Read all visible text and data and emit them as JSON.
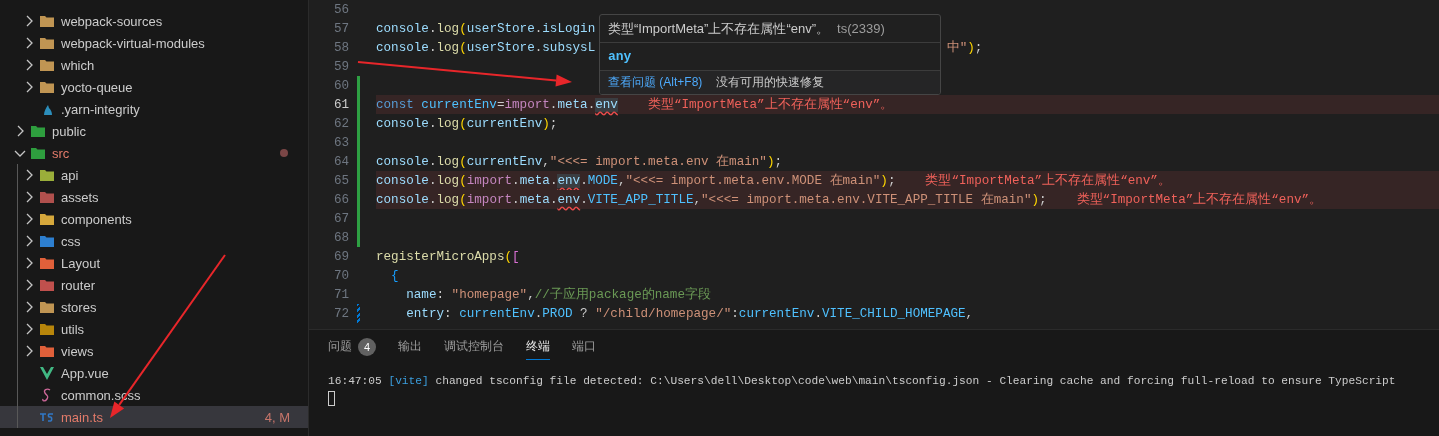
{
  "explorer": {
    "continued_children": [
      {
        "name": "webpack-sources",
        "kind": "folder",
        "color": "#c09553",
        "expanded": false,
        "selected": false
      },
      {
        "name": "webpack-virtual-modules",
        "kind": "folder",
        "color": "#c09553",
        "expanded": false,
        "selected": false
      },
      {
        "name": "which",
        "kind": "folder",
        "color": "#c09553",
        "expanded": false,
        "selected": false
      },
      {
        "name": "yocto-queue",
        "kind": "folder",
        "color": "#c09553",
        "expanded": false,
        "selected": false
      },
      {
        "name": ".yarn-integrity",
        "kind": "yarn",
        "selected": false
      }
    ],
    "items": [
      {
        "name": "public",
        "kind": "folder",
        "color": "#2e9e3e",
        "expanded": false,
        "selected": false
      },
      {
        "name": "src",
        "kind": "folder",
        "color": "#2e9e3e",
        "expanded": true,
        "selected": false,
        "modified": true,
        "dot": true,
        "children": [
          {
            "name": "api",
            "kind": "folder",
            "color": "#9aae3a",
            "expanded": false,
            "selected": false
          },
          {
            "name": "assets",
            "kind": "folder",
            "color": "#b0504d",
            "expanded": false,
            "selected": false
          },
          {
            "name": "components",
            "kind": "folder",
            "color": "#d6a83c",
            "expanded": false,
            "selected": false
          },
          {
            "name": "css",
            "kind": "folder",
            "color": "#2d7fd0",
            "expanded": false,
            "selected": false
          },
          {
            "name": "Layout",
            "kind": "folder",
            "color": "#e0603a",
            "expanded": false,
            "selected": false
          },
          {
            "name": "router",
            "kind": "folder",
            "color": "#c0504d",
            "expanded": false,
            "selected": false
          },
          {
            "name": "stores",
            "kind": "folder",
            "color": "#c09553",
            "expanded": false,
            "selected": false
          },
          {
            "name": "utils",
            "kind": "folder",
            "color": "#b8860b",
            "expanded": false,
            "selected": false
          },
          {
            "name": "views",
            "kind": "folder",
            "color": "#e0603a",
            "expanded": false,
            "selected": false
          },
          {
            "name": "App.vue",
            "kind": "vue",
            "selected": false
          },
          {
            "name": "common.scss",
            "kind": "sass",
            "selected": false
          },
          {
            "name": "main.ts",
            "kind": "ts",
            "selected": true,
            "modified": true,
            "badge": "4, M"
          }
        ]
      }
    ]
  },
  "editor": {
    "lines": [
      {
        "number": "56",
        "current": false
      },
      {
        "number": "57",
        "current": false,
        "tokens": [
          {
            "text": "console",
            "kind": "var"
          },
          {
            "text": ".",
            "kind": "punct"
          },
          {
            "text": "log",
            "kind": "func"
          },
          {
            "text": "(",
            "kind": "b1"
          },
          {
            "text": "userStore",
            "kind": "var"
          },
          {
            "text": ".",
            "kind": "punct"
          },
          {
            "text": "isLogin",
            "kind": "var"
          }
        ]
      },
      {
        "number": "58",
        "current": false,
        "tokens": [
          {
            "text": "console",
            "kind": "var"
          },
          {
            "text": ".",
            "kind": "punct"
          },
          {
            "text": "log",
            "kind": "func"
          },
          {
            "text": "(",
            "kind": "b1"
          },
          {
            "text": "userStore",
            "kind": "var"
          },
          {
            "text": ".",
            "kind": "punct"
          },
          {
            "text": "subsysL",
            "kind": "var"
          },
          {
            "text": "中\"",
            "kind": "string",
            "after_popup": true
          },
          {
            "text": ")",
            "kind": "b1"
          },
          {
            "text": ";",
            "kind": "punct"
          }
        ]
      },
      {
        "number": "59",
        "current": false
      },
      {
        "number": "60",
        "current": false,
        "added": true
      },
      {
        "number": "61",
        "current": true,
        "added": true,
        "error": "类型“ImportMeta”上不存在属性“env”。",
        "tokens": [
          {
            "text": "const",
            "kind": "keyword"
          },
          {
            "text": " currentEnv",
            "kind": "const"
          },
          {
            "text": "=",
            "kind": "punct"
          },
          {
            "text": "import",
            "kind": "control"
          },
          {
            "text": ".",
            "kind": "punct"
          },
          {
            "text": "meta",
            "kind": "var"
          },
          {
            "text": ".",
            "kind": "punct"
          },
          {
            "text": "env",
            "kind": "var",
            "squiggle": true,
            "highlight": true
          }
        ]
      },
      {
        "number": "62",
        "current": false,
        "added": true,
        "tokens": [
          {
            "text": "console",
            "kind": "var"
          },
          {
            "text": ".",
            "kind": "punct"
          },
          {
            "text": "log",
            "kind": "func"
          },
          {
            "text": "(",
            "kind": "b1"
          },
          {
            "text": "currentEnv",
            "kind": "var"
          },
          {
            "text": ")",
            "kind": "b1"
          },
          {
            "text": ";",
            "kind": "punct"
          }
        ]
      },
      {
        "number": "63",
        "current": false,
        "added": true
      },
      {
        "number": "64",
        "current": false,
        "added": true,
        "tokens": [
          {
            "text": "console",
            "kind": "var"
          },
          {
            "text": ".",
            "kind": "punct"
          },
          {
            "text": "log",
            "kind": "func"
          },
          {
            "text": "(",
            "kind": "b1"
          },
          {
            "text": "currentEnv",
            "kind": "var"
          },
          {
            "text": ",",
            "kind": "punct"
          },
          {
            "text": "\"<<<= import.meta.env 在main\"",
            "kind": "string"
          },
          {
            "text": ")",
            "kind": "b1"
          },
          {
            "text": ";",
            "kind": "punct"
          }
        ]
      },
      {
        "number": "65",
        "current": false,
        "added": true,
        "error": "类型“ImportMeta”上不存在属性“env”。",
        "tokens": [
          {
            "text": "console",
            "kind": "var"
          },
          {
            "text": ".",
            "kind": "punct"
          },
          {
            "text": "log",
            "kind": "func"
          },
          {
            "text": "(",
            "kind": "b1"
          },
          {
            "text": "import",
            "kind": "control"
          },
          {
            "text": ".",
            "kind": "punct"
          },
          {
            "text": "meta",
            "kind": "var"
          },
          {
            "text": ".",
            "kind": "punct"
          },
          {
            "text": "env",
            "kind": "var",
            "squiggle": true,
            "highlight": true
          },
          {
            "text": ".",
            "kind": "punct"
          },
          {
            "text": "MODE",
            "kind": "const"
          },
          {
            "text": ",",
            "kind": "punct"
          },
          {
            "text": "\"<<<= import.meta.env.MODE 在main\"",
            "kind": "string"
          },
          {
            "text": ")",
            "kind": "b1"
          },
          {
            "text": ";",
            "kind": "punct"
          }
        ]
      },
      {
        "number": "66",
        "current": false,
        "added": true,
        "error": "类型“ImportMeta”上不存在属性“env”。",
        "tokens": [
          {
            "text": "console",
            "kind": "var"
          },
          {
            "text": ".",
            "kind": "punct"
          },
          {
            "text": "log",
            "kind": "func"
          },
          {
            "text": "(",
            "kind": "b1"
          },
          {
            "text": "import",
            "kind": "control"
          },
          {
            "text": ".",
            "kind": "punct"
          },
          {
            "text": "meta",
            "kind": "var"
          },
          {
            "text": ".",
            "kind": "punct"
          },
          {
            "text": "env",
            "kind": "var",
            "squiggle": true,
            "highlight": false
          },
          {
            "text": ".",
            "kind": "punct"
          },
          {
            "text": "VITE_APP_TITLE",
            "kind": "const"
          },
          {
            "text": ",",
            "kind": "punct"
          },
          {
            "text": "\"<<<= import.meta.env.VITE_APP_TITLE 在main\"",
            "kind": "string"
          },
          {
            "text": ")",
            "kind": "b1"
          },
          {
            "text": ";",
            "kind": "punct"
          }
        ]
      },
      {
        "number": "67",
        "current": false,
        "added": true
      },
      {
        "number": "68",
        "current": false,
        "added": true
      },
      {
        "number": "69",
        "current": false,
        "tokens": [
          {
            "text": "registerMicroApps",
            "kind": "func"
          },
          {
            "text": "(",
            "kind": "b1"
          },
          {
            "text": "[",
            "kind": "b2"
          }
        ]
      },
      {
        "number": "70",
        "current": false,
        "tokens": [
          {
            "text": "  {",
            "kind": "b3"
          }
        ]
      },
      {
        "number": "71",
        "current": false,
        "tokens": [
          {
            "text": "    name",
            "kind": "var"
          },
          {
            "text": ": ",
            "kind": "punct"
          },
          {
            "text": "\"homepage\"",
            "kind": "string"
          },
          {
            "text": ",",
            "kind": "punct"
          },
          {
            "text": "//子应用package的name字段",
            "kind": "comment"
          }
        ]
      },
      {
        "number": "72",
        "current": false,
        "modified": true,
        "tokens": [
          {
            "text": "    entry",
            "kind": "var"
          },
          {
            "text": ": ",
            "kind": "punct"
          },
          {
            "text": "currentEnv",
            "kind": "const"
          },
          {
            "text": ".",
            "kind": "punct"
          },
          {
            "text": "PROD",
            "kind": "const"
          },
          {
            "text": " ? ",
            "kind": "punct"
          },
          {
            "text": "\"/child/homepage/\"",
            "kind": "string"
          },
          {
            "text": ":",
            "kind": "punct"
          },
          {
            "text": "currentEnv",
            "kind": "const"
          },
          {
            "text": ".",
            "kind": "punct"
          },
          {
            "text": "VITE_CHILD_HOMEPAGE",
            "kind": "const"
          },
          {
            "text": ",",
            "kind": "punct"
          }
        ]
      }
    ],
    "hover": {
      "message": "类型“ImportMeta”上不存在属性“env”。",
      "code": "ts(2339)",
      "type": "any",
      "action": "查看问题 (Alt+F8)",
      "note": "没有可用的快速修复"
    }
  },
  "panel": {
    "tabs": [
      {
        "label": "问题",
        "count": "4",
        "selected": false
      },
      {
        "label": "输出",
        "selected": false
      },
      {
        "label": "调试控制台",
        "selected": false
      },
      {
        "label": "终端",
        "selected": true
      },
      {
        "label": "端口",
        "selected": false
      }
    ],
    "terminal": {
      "time": "16:47:05",
      "source": "[vite]",
      "message": "changed tsconfig file detected: C:\\Users\\dell\\Desktop\\code\\web\\main\\tsconfig.json - Clearing cache and forcing full-reload to ensure TypeScript",
      "cursor": true
    }
  }
}
